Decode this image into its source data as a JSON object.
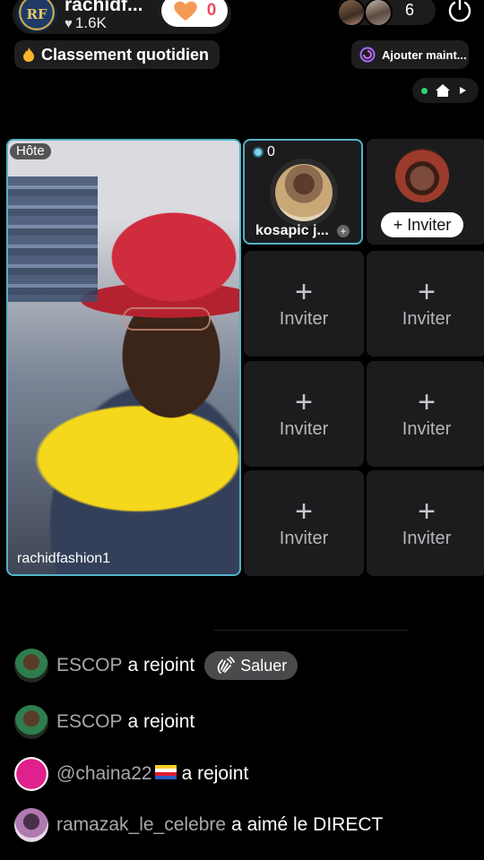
{
  "header": {
    "host_logo_text": "RF",
    "host_name": "rachidf...",
    "host_likes": "1.6K",
    "gift_count": "0",
    "viewer_count": "6"
  },
  "badges": {
    "daily_ranking": "Classement quotidien",
    "add_now": "Ajouter maint..."
  },
  "grid": {
    "host_badge": "Hôte",
    "host_username": "rachidfashion1",
    "guest": {
      "count": "0",
      "name": "kosapic j...",
      "plus": "+"
    },
    "invite_button": "+ Inviter",
    "slots": [
      {
        "plus": "+",
        "label": "Inviter"
      },
      {
        "plus": "+",
        "label": "Inviter"
      },
      {
        "plus": "+",
        "label": "Inviter"
      },
      {
        "plus": "+",
        "label": "Inviter"
      },
      {
        "plus": "+",
        "label": "Inviter"
      },
      {
        "plus": "+",
        "label": "Inviter"
      }
    ]
  },
  "feed": [
    {
      "user": "ESCOP",
      "action": "a rejoint",
      "button": "Saluer"
    },
    {
      "user": "ESCOP",
      "action": "a rejoint"
    },
    {
      "user": "@chaina22",
      "action": "a rejoint"
    },
    {
      "user": "ramazak_le_celebre",
      "action": "a aimé le DIRECT"
    }
  ],
  "colors": {
    "accent_border": "#52b3c8",
    "gift_red": "#f04c63",
    "live_green": "#2ed573"
  },
  "icons": [
    "heart-icon",
    "gift-heart-icon",
    "power-icon",
    "fire-icon",
    "swirl-icon",
    "home-icon",
    "play-icon",
    "wave-icon"
  ]
}
